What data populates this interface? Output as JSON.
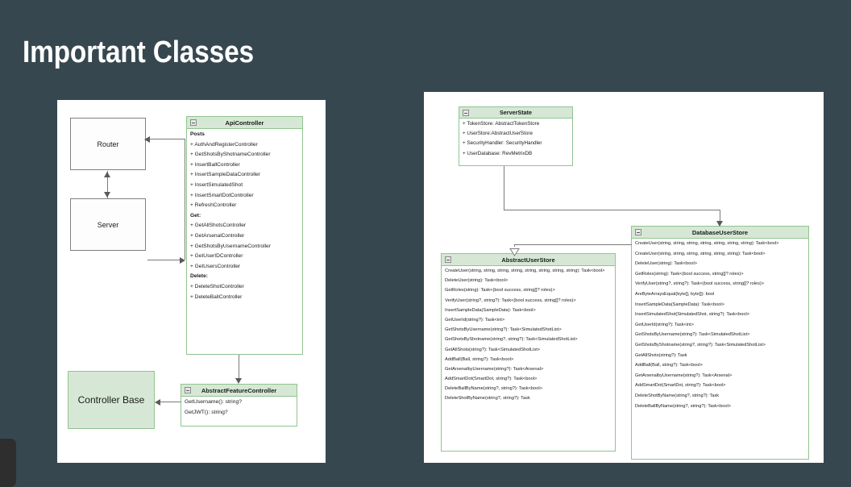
{
  "slide": {
    "title": "Important Classes",
    "background_color": "#36474f",
    "title_color": "#ffffff",
    "uml_header_color": "#d6e8d5",
    "uml_border_color": "#91c491"
  },
  "left_panel": {
    "boxes": {
      "router": {
        "label": "Router"
      },
      "server": {
        "label": "Server"
      },
      "controller_base": {
        "label": "Controller Base"
      }
    },
    "api_controller": {
      "collapse_icon": "collapse-box-icon",
      "title": "ApiController",
      "members": [
        {
          "text": "Posts",
          "bold": true
        },
        {
          "text": "+ AuthAndRegisterController",
          "bold": false
        },
        {
          "text": "+ GetShotsByShotnameController",
          "bold": false
        },
        {
          "text": "+ InsertBallController",
          "bold": false
        },
        {
          "text": "+ InsertSampleDataController",
          "bold": false
        },
        {
          "text": "+ InsertSimulatedShot",
          "bold": false
        },
        {
          "text": "+ InsertSmartDotController",
          "bold": false
        },
        {
          "text": "+ RefreshController",
          "bold": false
        },
        {
          "text": "Get:",
          "bold": true
        },
        {
          "text": "+ GetAllShotsController",
          "bold": false
        },
        {
          "text": "+ GetArsenalController",
          "bold": false
        },
        {
          "text": "+ GetShotsByUsernameController",
          "bold": false
        },
        {
          "text": "+ GetUserIDController",
          "bold": false
        },
        {
          "text": "+ GetUsersController",
          "bold": false
        },
        {
          "text": "Delete:",
          "bold": true
        },
        {
          "text": "+ DeleteShotController",
          "bold": false
        },
        {
          "text": "+ DeleteBallController",
          "bold": false
        }
      ]
    },
    "abstract_feature_controller": {
      "collapse_icon": "collapse-box-icon",
      "title": "AbstractFeatureController",
      "members": [
        {
          "text": "GetUsername(): string?",
          "bold": false
        },
        {
          "text": "GetJWT(): string?",
          "bold": false
        }
      ]
    }
  },
  "right_panel": {
    "server_state": {
      "collapse_icon": "collapse-box-icon",
      "title": "ServerState",
      "members": [
        {
          "text": "+ TokenStore: AbstractTokenStore",
          "bold": false
        },
        {
          "text": "+ UserStore:AbstractUserStore",
          "bold": false
        },
        {
          "text": "+ SecurityHandler: SecurityHandler",
          "bold": false
        },
        {
          "text": "+ UserDatabase: RevMetrixDB",
          "bold": false
        }
      ]
    },
    "abstract_user_store": {
      "collapse_icon": "collapse-box-icon",
      "title": "AbstractUserStore",
      "members": [
        {
          "text": "CreateUser(string, string, string, string, string, string, string, string): Task<bool>",
          "bold": false,
          "wrap": true
        },
        {
          "text": "DeleteUser(string): Task<bool>",
          "bold": false
        },
        {
          "text": "GetRoles(string): Task<(bool success, string[]? roles)>",
          "bold": false
        },
        {
          "text": "VerifyUser(string?, string?): Task<(bool success, string[]? roles)>",
          "bold": false
        },
        {
          "text": "InsertSampleData(SampleData): Task<bool>",
          "bold": false
        },
        {
          "text": "GetUserId(string?): Task<int>",
          "bold": false
        },
        {
          "text": "GetShotsByUsername(string?): Task<SimulatedShotList>",
          "bold": false
        },
        {
          "text": "GetShotsByShotname(string?, string?): Task<SimulatedShotList>",
          "bold": false
        },
        {
          "text": "GetAllShots(string?): Task<SimulatedShotList>",
          "bold": false
        },
        {
          "text": "AddBall(Ball, string?): Task<bool>",
          "bold": false
        },
        {
          "text": "GetArsenalbyUsername(string?): Task<Arsenal>",
          "bold": false
        },
        {
          "text": "AddSmartDot(SmartDot, string?): Task<bool>",
          "bold": false
        },
        {
          "text": "DeleteBallByName(string?, string?): Task<bool>",
          "bold": false
        },
        {
          "text": "DeleteShotByName(string?, string?): Task",
          "bold": false
        }
      ]
    },
    "database_user_store": {
      "collapse_icon": "collapse-box-icon",
      "title": "DatabaseUserStore",
      "members": [
        {
          "text": "CreateUser(string, string, string, string, string, string, string): Task<bool>",
          "bold": false
        },
        {
          "text": "CreateUser(string, string, string, string, string, string): Task<bool>",
          "bold": false
        },
        {
          "text": "DeleteUser(string): Task<bool>",
          "bold": false
        },
        {
          "text": "GetRoles(string): Task<(bool success, string[]? roles)>",
          "bold": false
        },
        {
          "text": "VerifyUser(string?, string?): Task<(bool success, string[]? roles)>",
          "bold": false
        },
        {
          "text": "AreByteArraysEqual(byte[], byte[]): bool",
          "bold": false
        },
        {
          "text": "InsertSampleData(SampleData): Task<bool>",
          "bold": false
        },
        {
          "text": "InsertSimulatedShot(SimulatedShot, string?): Task<bool>",
          "bold": false
        },
        {
          "text": "GetUserId(string?): Task<int>",
          "bold": false
        },
        {
          "text": "GetShotsByUsername(string?): Task<SimulatedShotList>",
          "bold": false
        },
        {
          "text": "GetShotsByShotname(string?, string?): Task<SimulatedShotList>",
          "bold": false
        },
        {
          "text": "GetAllShots(string?): Task",
          "bold": false
        },
        {
          "text": "AddBall(Ball, string?): Task<bool>",
          "bold": false
        },
        {
          "text": "GetArsenalbyUsername(string?): Task<Arsenal>",
          "bold": false
        },
        {
          "text": "AddSmartDot(SmartDot, string?): Task<bool>",
          "bold": false
        },
        {
          "text": "DeleteShotByName(string?, string?): Task",
          "bold": false
        },
        {
          "text": "DeleteBallByName(string?, string?): Task<bool>",
          "bold": false
        }
      ]
    }
  }
}
